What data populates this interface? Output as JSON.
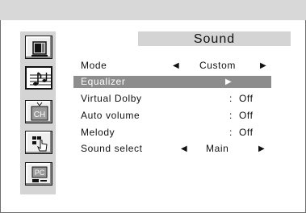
{
  "menu": {
    "title": "Sound",
    "rows": [
      {
        "label": "Mode",
        "value": "Custom",
        "left_arrow": "◀",
        "right_arrow": "▶"
      },
      {
        "label": "Equalizer",
        "right_arrow": "▶"
      },
      {
        "label": "Virtual Dolby",
        "colon": ":",
        "value": "Off"
      },
      {
        "label": "Auto volume",
        "colon": ":",
        "value": "Off"
      },
      {
        "label": "Melody",
        "colon": ":",
        "value": "Off"
      },
      {
        "label": "Sound select",
        "value": "Main",
        "left_arrow": "◀",
        "right_arrow": "▶"
      }
    ]
  },
  "sidebar": {
    "items": [
      {
        "icon": "tv-picture-icon",
        "selected": false
      },
      {
        "icon": "sound-note-icon",
        "selected": true
      },
      {
        "icon": "channel-icon",
        "label": "CH",
        "selected": false
      },
      {
        "icon": "setup-icon",
        "selected": false
      },
      {
        "icon": "pc-icon",
        "label": "PC",
        "selected": false
      }
    ]
  },
  "colors": {
    "highlight": "#8d8d8d",
    "sidebar": "#d4d4d4",
    "title_bar": "#d4d4d4"
  }
}
